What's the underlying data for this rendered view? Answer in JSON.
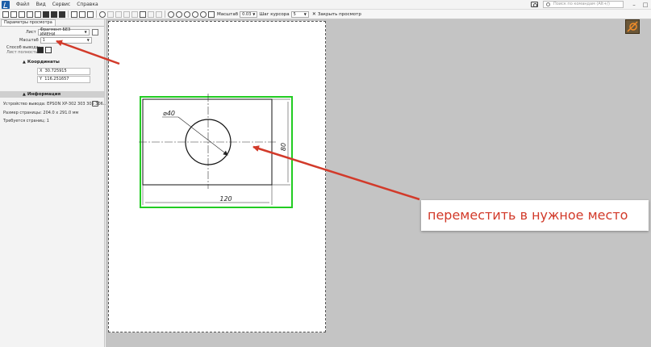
{
  "menubar": {
    "items": [
      "Файл",
      "Вид",
      "Сервис",
      "Справка"
    ],
    "search_placeholder": "Поиск по командам (Alt+/)",
    "window_controls": [
      "–",
      "□"
    ]
  },
  "toolbar": {
    "scale_label": "Масштаб",
    "scale_value": "0.03",
    "step_label": "Шаг курсора",
    "step_value": "5",
    "close_preview": "Закрыть просмотр"
  },
  "panel": {
    "tab": "Параметры просмотра",
    "sheet_label": "Лист",
    "sheet_value": "Фрагмент БЕЗ ИМЕНИ",
    "scale_label": "Масштаб",
    "scale_value": "1",
    "output_mode_label": "Способ вывода:",
    "output_mode_value": "Лист полностью",
    "coords_header": "Координаты",
    "coord_x_label": "X",
    "coord_x": "30.725915",
    "coord_y_label": "Y",
    "coord_y": "116.251657",
    "info_header": "Информация",
    "device_label": "Устройство вывода:",
    "device_value": "EPSON XP-302 303 305 306...",
    "page_size_label": "Размер страницы:",
    "page_size_value": "204.0 x 291.0 мм",
    "pages_label": "Требуется страниц:",
    "pages_value": "1"
  },
  "drawing": {
    "diameter_label": "⌀40",
    "width_label": "120",
    "height_label": "80"
  },
  "annotation": {
    "text": "переместить в нужное место"
  },
  "colors": {
    "arrow": "#d23a2a",
    "selection": "#22cc22",
    "workspace": "#c4c4c4"
  }
}
